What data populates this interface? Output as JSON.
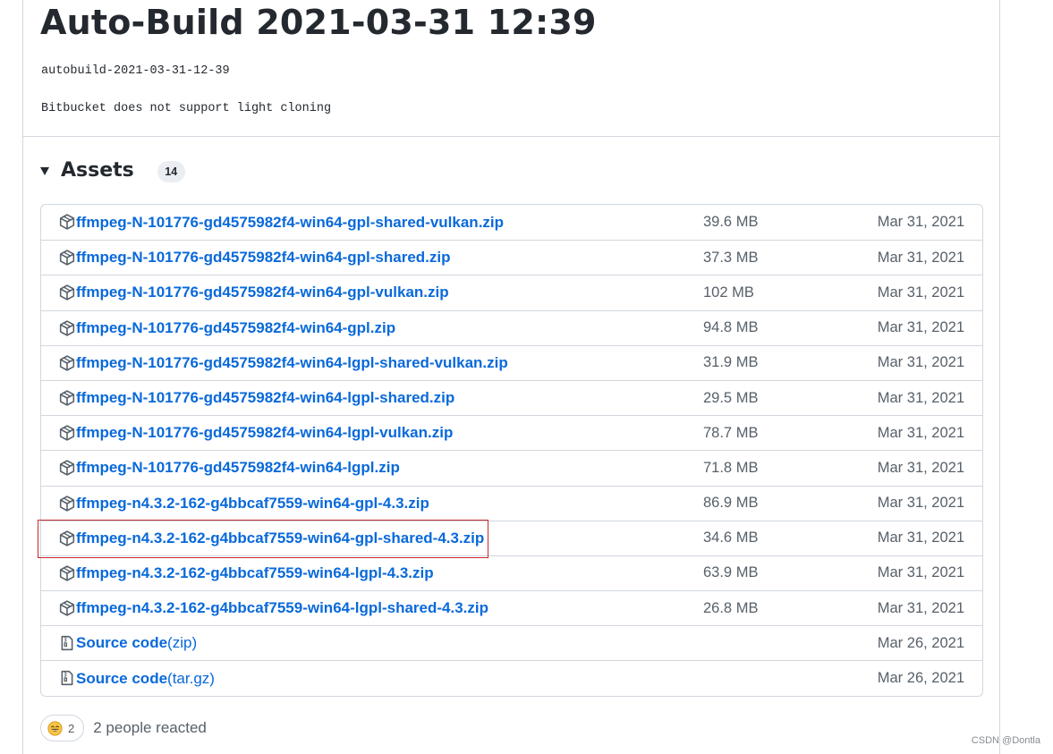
{
  "release": {
    "title": "Auto-Build 2021-03-31 12:39",
    "tag": "autobuild-2021-03-31-12-39",
    "note": "Bitbucket does not support light cloning"
  },
  "assets": {
    "title": "Assets",
    "count": "14",
    "items": [
      {
        "name": "ffmpeg-N-101776-gd4575982f4-win64-gpl-shared-vulkan.zip",
        "suffix": "",
        "size": "39.6 MB",
        "date": "Mar 31, 2021",
        "icon": "package-icon"
      },
      {
        "name": "ffmpeg-N-101776-gd4575982f4-win64-gpl-shared.zip",
        "suffix": "",
        "size": "37.3 MB",
        "date": "Mar 31, 2021",
        "icon": "package-icon"
      },
      {
        "name": "ffmpeg-N-101776-gd4575982f4-win64-gpl-vulkan.zip",
        "suffix": "",
        "size": "102 MB",
        "date": "Mar 31, 2021",
        "icon": "package-icon"
      },
      {
        "name": "ffmpeg-N-101776-gd4575982f4-win64-gpl.zip",
        "suffix": "",
        "size": "94.8 MB",
        "date": "Mar 31, 2021",
        "icon": "package-icon"
      },
      {
        "name": "ffmpeg-N-101776-gd4575982f4-win64-lgpl-shared-vulkan.zip",
        "suffix": "",
        "size": "31.9 MB",
        "date": "Mar 31, 2021",
        "icon": "package-icon"
      },
      {
        "name": "ffmpeg-N-101776-gd4575982f4-win64-lgpl-shared.zip",
        "suffix": "",
        "size": "29.5 MB",
        "date": "Mar 31, 2021",
        "icon": "package-icon"
      },
      {
        "name": "ffmpeg-N-101776-gd4575982f4-win64-lgpl-vulkan.zip",
        "suffix": "",
        "size": "78.7 MB",
        "date": "Mar 31, 2021",
        "icon": "package-icon"
      },
      {
        "name": "ffmpeg-N-101776-gd4575982f4-win64-lgpl.zip",
        "suffix": "",
        "size": "71.8 MB",
        "date": "Mar 31, 2021",
        "icon": "package-icon"
      },
      {
        "name": "ffmpeg-n4.3.2-162-g4bbcaf7559-win64-gpl-4.3.zip",
        "suffix": "",
        "size": "86.9 MB",
        "date": "Mar 31, 2021",
        "icon": "package-icon"
      },
      {
        "name": "ffmpeg-n4.3.2-162-g4bbcaf7559-win64-gpl-shared-4.3.zip",
        "suffix": "",
        "size": "34.6 MB",
        "date": "Mar 31, 2021",
        "icon": "package-icon"
      },
      {
        "name": "ffmpeg-n4.3.2-162-g4bbcaf7559-win64-lgpl-4.3.zip",
        "suffix": "",
        "size": "63.9 MB",
        "date": "Mar 31, 2021",
        "icon": "package-icon"
      },
      {
        "name": "ffmpeg-n4.3.2-162-g4bbcaf7559-win64-lgpl-shared-4.3.zip",
        "suffix": "",
        "size": "26.8 MB",
        "date": "Mar 31, 2021",
        "icon": "package-icon"
      },
      {
        "name": "Source code",
        "suffix": "(zip)",
        "size": "",
        "date": "Mar 26, 2021",
        "icon": "file-zip-icon"
      },
      {
        "name": "Source code",
        "suffix": "(tar.gz)",
        "size": "",
        "date": "Mar 26, 2021",
        "icon": "file-zip-icon"
      }
    ]
  },
  "reactions": {
    "emoji_count": "2",
    "summary": "2 people reacted"
  },
  "watermark": "CSDN @Dontla",
  "colors": {
    "link": "#0969da",
    "muted": "#57606a",
    "border": "#d0d7de",
    "highlight": "#c9292c"
  }
}
